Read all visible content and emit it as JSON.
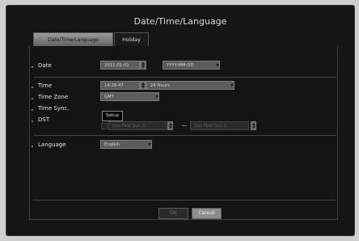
{
  "window": {
    "title": "Date/Time/Language"
  },
  "tabs": [
    {
      "label": "Date/Time/Language"
    },
    {
      "label": "Holiday"
    }
  ],
  "rows": {
    "date": {
      "label": "Date",
      "value": "2011-01-01",
      "format": "YYYY-MM-DD"
    },
    "time": {
      "label": "Time",
      "value": "14:28:47",
      "format": "24 Hours"
    },
    "time_zone": {
      "label": "Time Zone",
      "value": "GMT"
    },
    "time_sync": {
      "label": "Time Sync.",
      "button": "Setup"
    },
    "dst": {
      "label": "DST",
      "start": "Dec First Sun 0",
      "end": "Dec First Sun 0"
    },
    "language": {
      "label": "Language",
      "value": "English"
    }
  },
  "buttons": {
    "ok": "OK",
    "cancel": "Cancel"
  }
}
